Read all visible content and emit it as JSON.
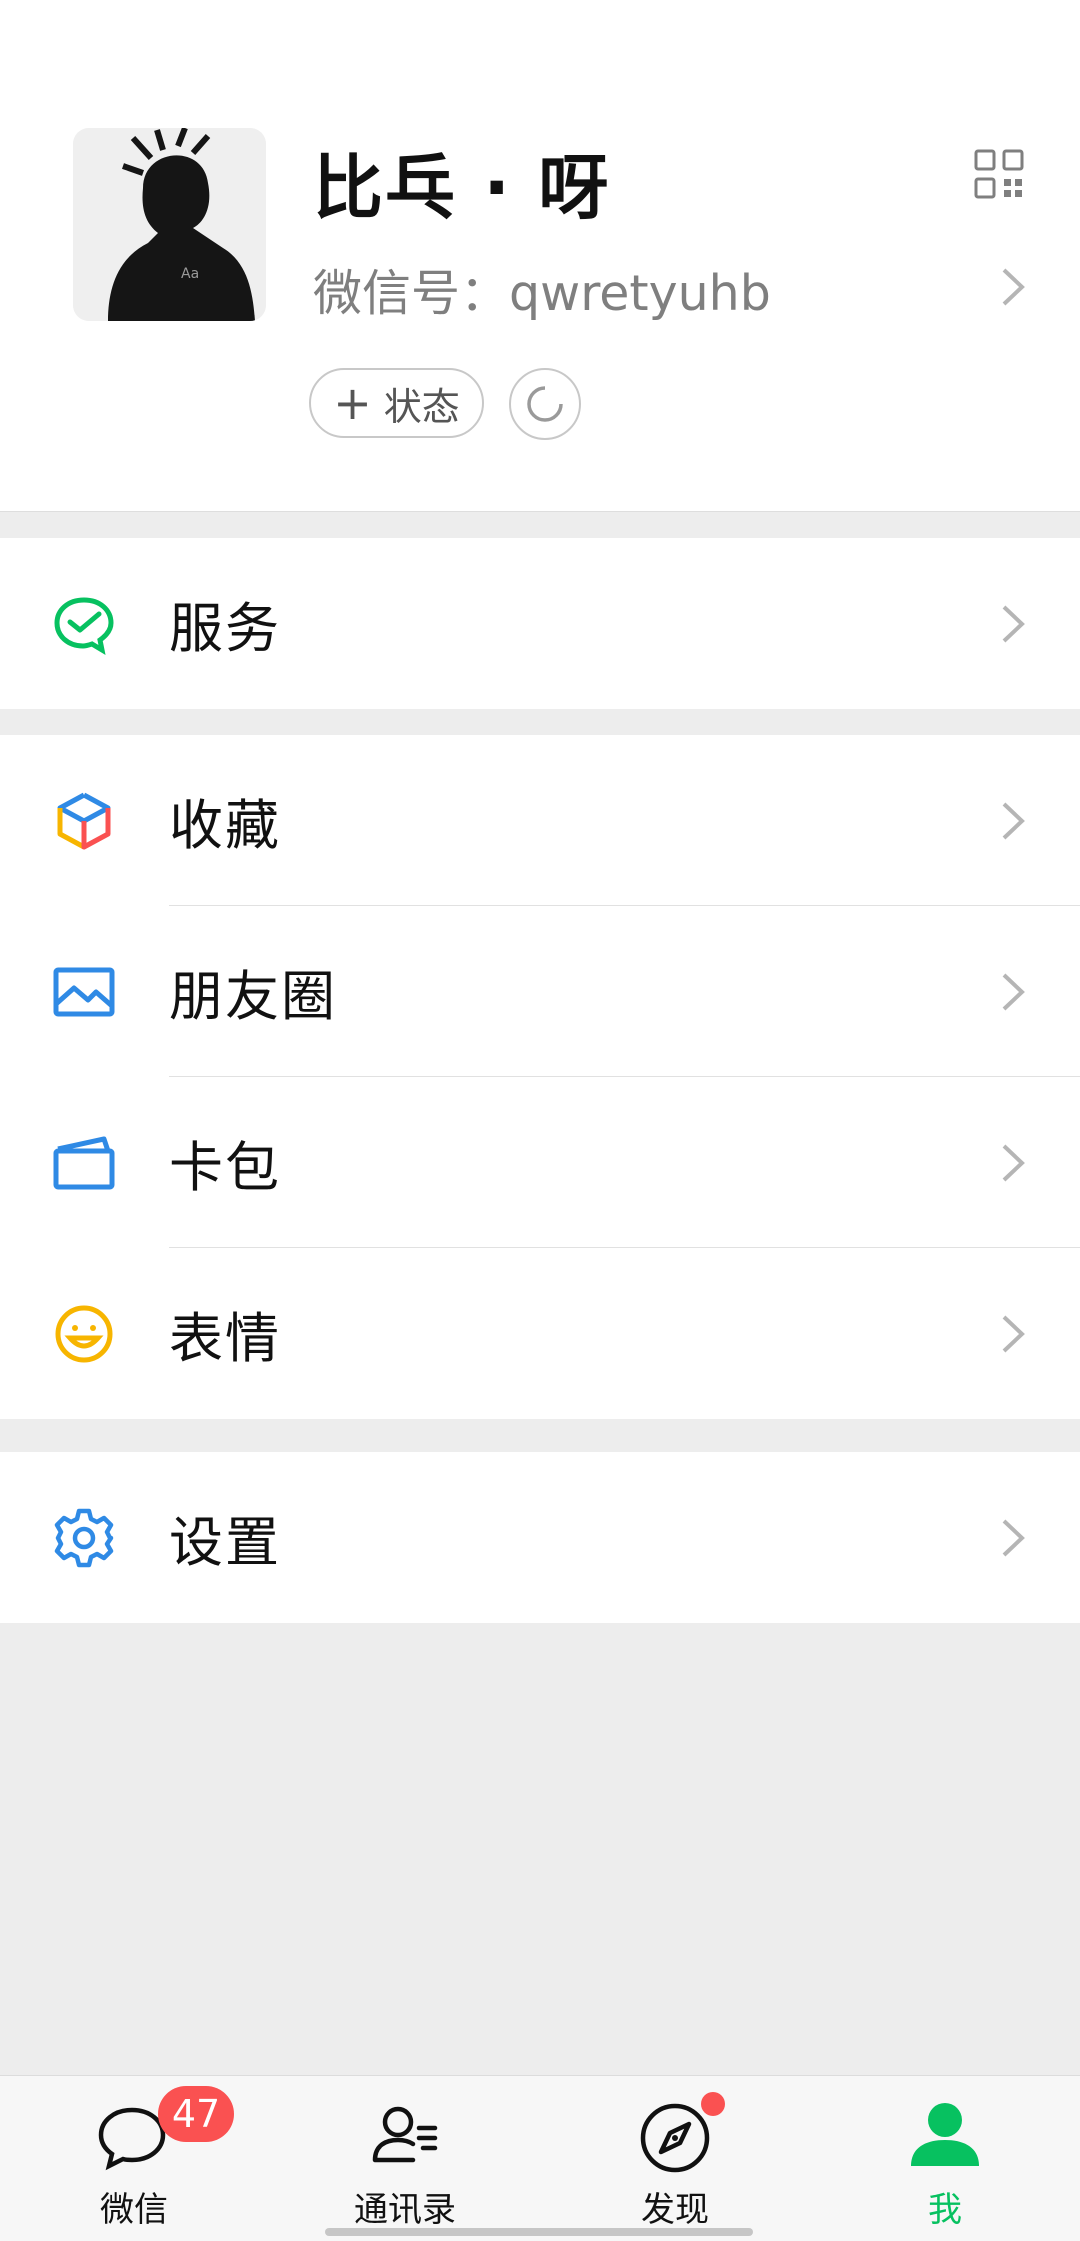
{
  "profile": {
    "name": "比乓 · 呀",
    "wechat_id_label": "微信号：",
    "wechat_id": "qwretyuhb",
    "status_button": {
      "icon": "plus-icon",
      "label": "状态"
    },
    "refresh_icon": "refresh-icon",
    "qr_icon": "qr-code-icon"
  },
  "sections": [
    {
      "items": [
        {
          "label": "服务",
          "icon": "wechat-pay-icon"
        }
      ]
    },
    {
      "items": [
        {
          "label": "收藏",
          "icon": "favorites-cube-icon"
        },
        {
          "label": "朋友圈",
          "icon": "moments-image-icon"
        },
        {
          "label": "卡包",
          "icon": "card-wallet-icon"
        },
        {
          "label": "表情",
          "icon": "smiley-icon"
        }
      ]
    },
    {
      "items": [
        {
          "label": "设置",
          "icon": "settings-gear-icon"
        }
      ]
    }
  ],
  "tabbar": {
    "tabs": [
      {
        "label": "微信",
        "icon": "chat-bubble-icon",
        "badge": "47"
      },
      {
        "label": "通讯录",
        "icon": "contacts-icon"
      },
      {
        "label": "发现",
        "icon": "compass-icon",
        "dot": true
      },
      {
        "label": "我",
        "icon": "me-person-icon",
        "active": true
      }
    ]
  },
  "colors": {
    "accent": "#07c160",
    "badge": "#fa5151",
    "background": "#ededed"
  }
}
